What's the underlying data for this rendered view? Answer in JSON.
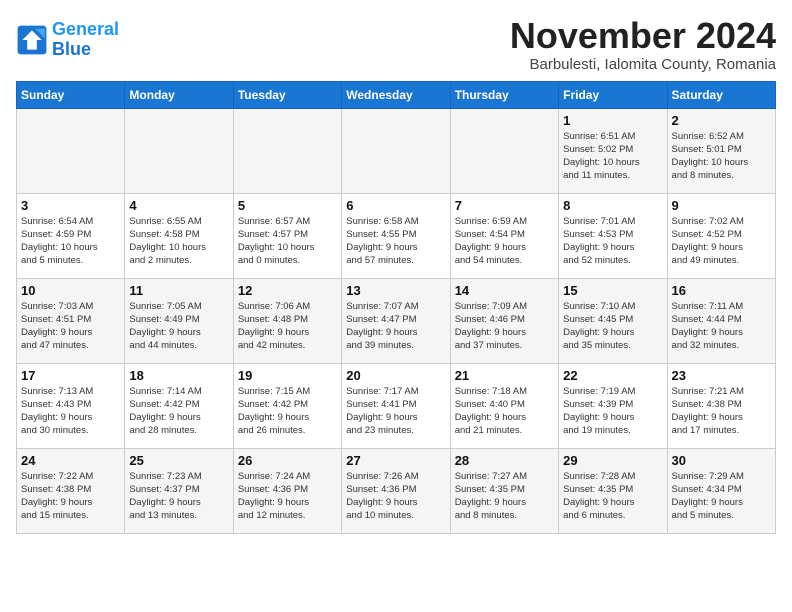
{
  "logo": {
    "line1": "General",
    "line2": "Blue"
  },
  "title": "November 2024",
  "subtitle": "Barbulesti, Ialomita County, Romania",
  "days_of_week": [
    "Sunday",
    "Monday",
    "Tuesday",
    "Wednesday",
    "Thursday",
    "Friday",
    "Saturday"
  ],
  "weeks": [
    [
      {
        "day": "",
        "info": ""
      },
      {
        "day": "",
        "info": ""
      },
      {
        "day": "",
        "info": ""
      },
      {
        "day": "",
        "info": ""
      },
      {
        "day": "",
        "info": ""
      },
      {
        "day": "1",
        "info": "Sunrise: 6:51 AM\nSunset: 5:02 PM\nDaylight: 10 hours\nand 11 minutes."
      },
      {
        "day": "2",
        "info": "Sunrise: 6:52 AM\nSunset: 5:01 PM\nDaylight: 10 hours\nand 8 minutes."
      }
    ],
    [
      {
        "day": "3",
        "info": "Sunrise: 6:54 AM\nSunset: 4:59 PM\nDaylight: 10 hours\nand 5 minutes."
      },
      {
        "day": "4",
        "info": "Sunrise: 6:55 AM\nSunset: 4:58 PM\nDaylight: 10 hours\nand 2 minutes."
      },
      {
        "day": "5",
        "info": "Sunrise: 6:57 AM\nSunset: 4:57 PM\nDaylight: 10 hours\nand 0 minutes."
      },
      {
        "day": "6",
        "info": "Sunrise: 6:58 AM\nSunset: 4:55 PM\nDaylight: 9 hours\nand 57 minutes."
      },
      {
        "day": "7",
        "info": "Sunrise: 6:59 AM\nSunset: 4:54 PM\nDaylight: 9 hours\nand 54 minutes."
      },
      {
        "day": "8",
        "info": "Sunrise: 7:01 AM\nSunset: 4:53 PM\nDaylight: 9 hours\nand 52 minutes."
      },
      {
        "day": "9",
        "info": "Sunrise: 7:02 AM\nSunset: 4:52 PM\nDaylight: 9 hours\nand 49 minutes."
      }
    ],
    [
      {
        "day": "10",
        "info": "Sunrise: 7:03 AM\nSunset: 4:51 PM\nDaylight: 9 hours\nand 47 minutes."
      },
      {
        "day": "11",
        "info": "Sunrise: 7:05 AM\nSunset: 4:49 PM\nDaylight: 9 hours\nand 44 minutes."
      },
      {
        "day": "12",
        "info": "Sunrise: 7:06 AM\nSunset: 4:48 PM\nDaylight: 9 hours\nand 42 minutes."
      },
      {
        "day": "13",
        "info": "Sunrise: 7:07 AM\nSunset: 4:47 PM\nDaylight: 9 hours\nand 39 minutes."
      },
      {
        "day": "14",
        "info": "Sunrise: 7:09 AM\nSunset: 4:46 PM\nDaylight: 9 hours\nand 37 minutes."
      },
      {
        "day": "15",
        "info": "Sunrise: 7:10 AM\nSunset: 4:45 PM\nDaylight: 9 hours\nand 35 minutes."
      },
      {
        "day": "16",
        "info": "Sunrise: 7:11 AM\nSunset: 4:44 PM\nDaylight: 9 hours\nand 32 minutes."
      }
    ],
    [
      {
        "day": "17",
        "info": "Sunrise: 7:13 AM\nSunset: 4:43 PM\nDaylight: 9 hours\nand 30 minutes."
      },
      {
        "day": "18",
        "info": "Sunrise: 7:14 AM\nSunset: 4:42 PM\nDaylight: 9 hours\nand 28 minutes."
      },
      {
        "day": "19",
        "info": "Sunrise: 7:15 AM\nSunset: 4:42 PM\nDaylight: 9 hours\nand 26 minutes."
      },
      {
        "day": "20",
        "info": "Sunrise: 7:17 AM\nSunset: 4:41 PM\nDaylight: 9 hours\nand 23 minutes."
      },
      {
        "day": "21",
        "info": "Sunrise: 7:18 AM\nSunset: 4:40 PM\nDaylight: 9 hours\nand 21 minutes."
      },
      {
        "day": "22",
        "info": "Sunrise: 7:19 AM\nSunset: 4:39 PM\nDaylight: 9 hours\nand 19 minutes."
      },
      {
        "day": "23",
        "info": "Sunrise: 7:21 AM\nSunset: 4:38 PM\nDaylight: 9 hours\nand 17 minutes."
      }
    ],
    [
      {
        "day": "24",
        "info": "Sunrise: 7:22 AM\nSunset: 4:38 PM\nDaylight: 9 hours\nand 15 minutes."
      },
      {
        "day": "25",
        "info": "Sunrise: 7:23 AM\nSunset: 4:37 PM\nDaylight: 9 hours\nand 13 minutes."
      },
      {
        "day": "26",
        "info": "Sunrise: 7:24 AM\nSunset: 4:36 PM\nDaylight: 9 hours\nand 12 minutes."
      },
      {
        "day": "27",
        "info": "Sunrise: 7:26 AM\nSunset: 4:36 PM\nDaylight: 9 hours\nand 10 minutes."
      },
      {
        "day": "28",
        "info": "Sunrise: 7:27 AM\nSunset: 4:35 PM\nDaylight: 9 hours\nand 8 minutes."
      },
      {
        "day": "29",
        "info": "Sunrise: 7:28 AM\nSunset: 4:35 PM\nDaylight: 9 hours\nand 6 minutes."
      },
      {
        "day": "30",
        "info": "Sunrise: 7:29 AM\nSunset: 4:34 PM\nDaylight: 9 hours\nand 5 minutes."
      }
    ]
  ]
}
